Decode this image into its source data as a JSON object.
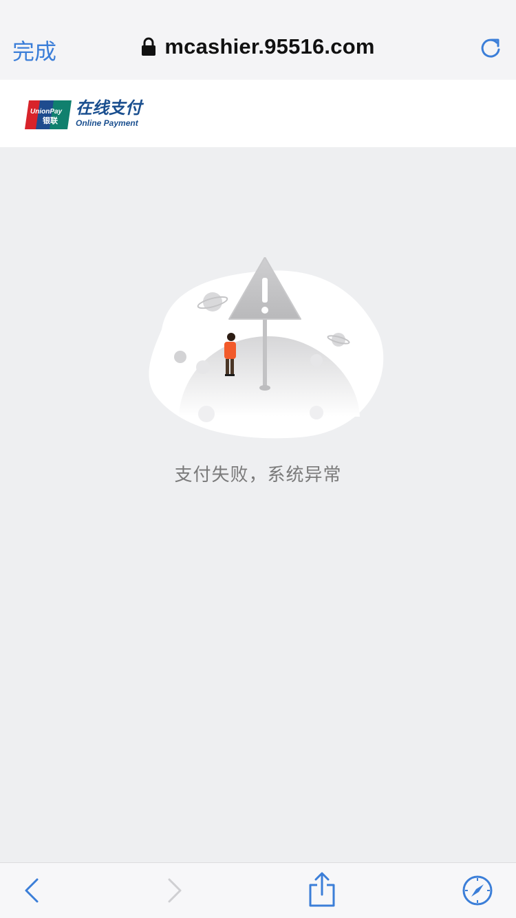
{
  "browser": {
    "done_label": "完成",
    "url": "mcashier.95516.com"
  },
  "brand": {
    "logo_text": "UnionPay 银联",
    "title_cn": "在线支付",
    "title_en": "Online Payment"
  },
  "main": {
    "message": "支付失败，系统异常"
  },
  "toolbar": {
    "icons": [
      "back-icon",
      "forward-icon",
      "share-icon",
      "compass-icon"
    ]
  },
  "colors": {
    "accent": "#3b7ed8",
    "brand_blue": "#1a4f8f",
    "background": "#eeeff1"
  }
}
